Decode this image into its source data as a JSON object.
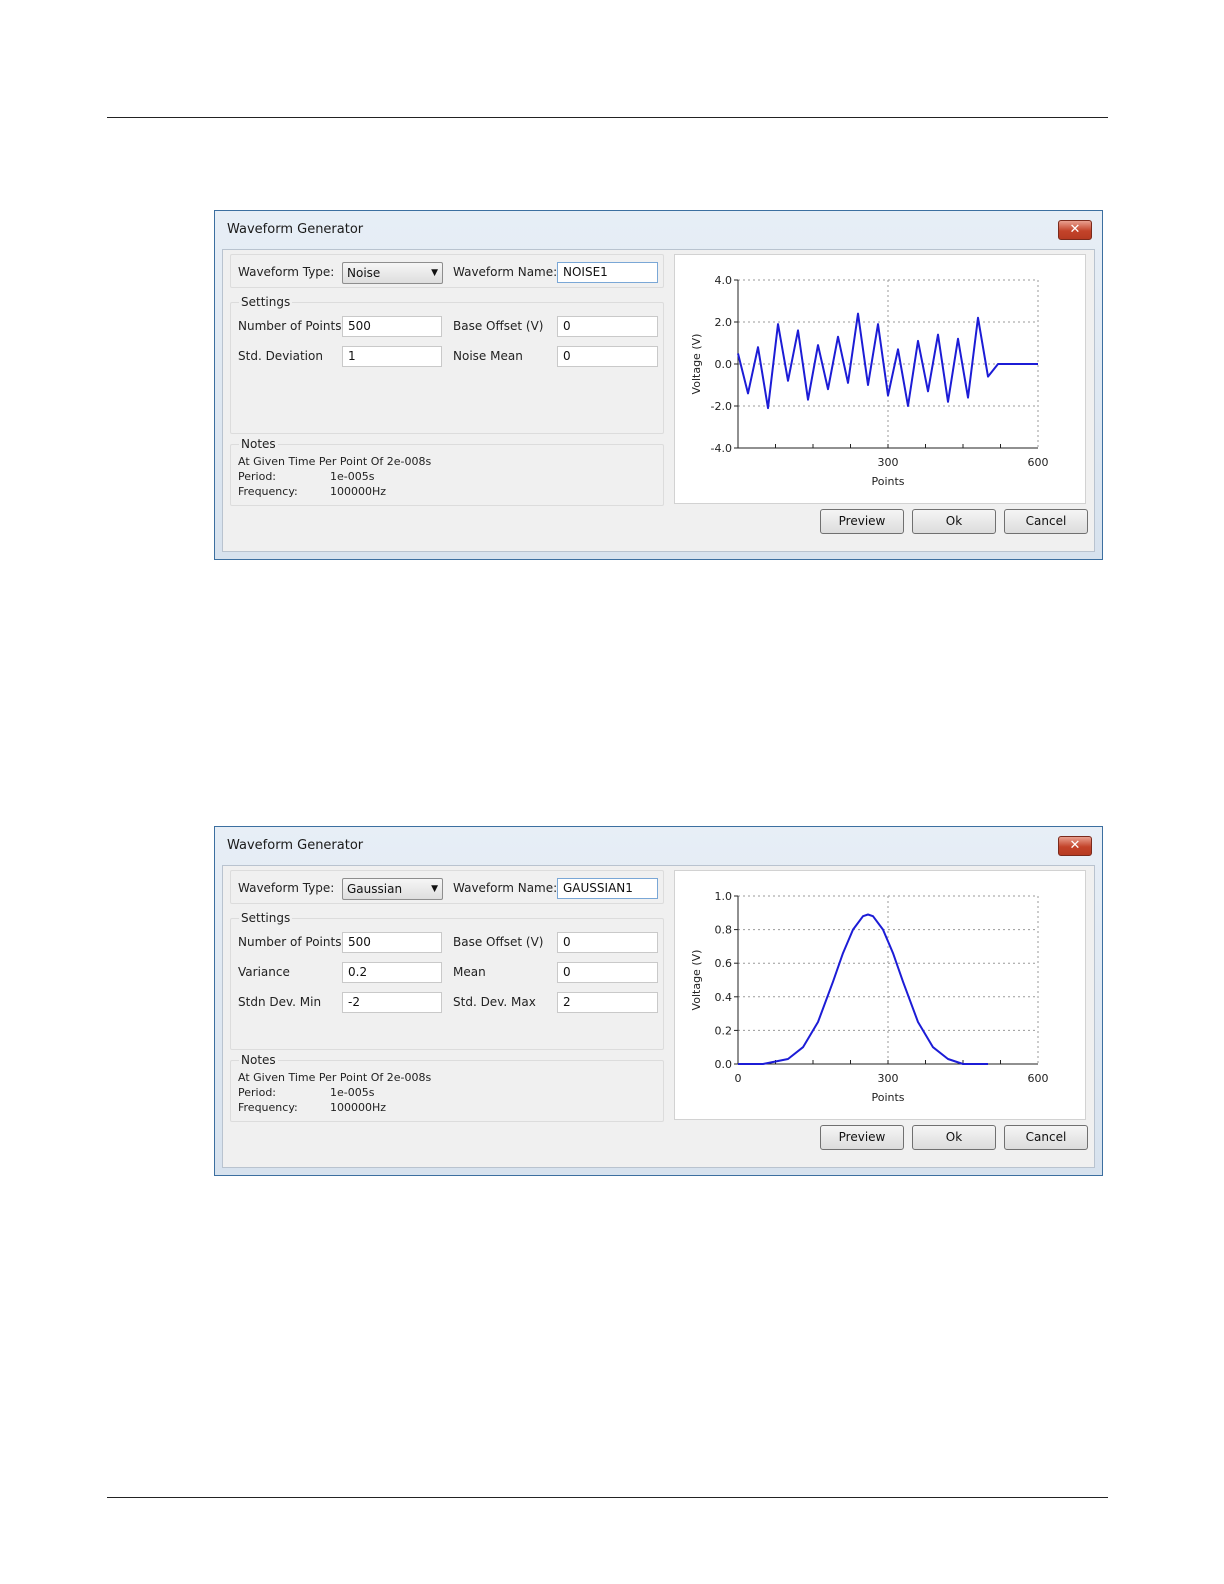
{
  "dialogs": [
    {
      "title": "Waveform Generator",
      "close_label": "✕",
      "waveform_type_label": "Waveform Type:",
      "waveform_type_value": "Noise",
      "waveform_name_label": "Waveform Name:",
      "waveform_name_value": "NOISE1",
      "settings_label": "Settings",
      "fields": [
        {
          "label": "Number of Points",
          "value": "500"
        },
        {
          "label": "Base Offset (V)",
          "value": "0"
        },
        {
          "label": "Std. Deviation",
          "value": "1"
        },
        {
          "label": "Noise Mean",
          "value": "0"
        }
      ],
      "notes_label": "Notes",
      "notes_line1": "At Given Time Per Point Of 2e-008s",
      "period_label": "Period:",
      "period_value": "1e-005s",
      "frequency_label": "Frequency:",
      "frequency_value": "100000Hz",
      "buttons": {
        "preview": "Preview",
        "ok": "Ok",
        "cancel": "Cancel"
      }
    },
    {
      "title": "Waveform Generator",
      "close_label": "✕",
      "waveform_type_label": "Waveform Type:",
      "waveform_type_value": "Gaussian",
      "waveform_name_label": "Waveform Name:",
      "waveform_name_value": "GAUSSIAN1",
      "settings_label": "Settings",
      "fields": [
        {
          "label": "Number of Points",
          "value": "500"
        },
        {
          "label": "Base Offset (V)",
          "value": "0"
        },
        {
          "label": "Variance",
          "value": "0.2"
        },
        {
          "label": "Mean",
          "value": "0"
        },
        {
          "label": "Stdn Dev. Min",
          "value": "-2"
        },
        {
          "label": "Std. Dev. Max",
          "value": "2"
        }
      ],
      "notes_label": "Notes",
      "notes_line1": "At Given Time Per Point Of 2e-008s",
      "period_label": "Period:",
      "period_value": "1e-005s",
      "frequency_label": "Frequency:",
      "frequency_value": "100000Hz",
      "buttons": {
        "preview": "Preview",
        "ok": "Ok",
        "cancel": "Cancel"
      }
    }
  ],
  "chart_data": [
    {
      "type": "line",
      "xlabel": "Points",
      "ylabel": "Voltage (V)",
      "xlim": [
        0,
        600
      ],
      "ylim": [
        -4.0,
        4.0
      ],
      "x_ticks": [
        "300",
        "600"
      ],
      "y_ticks": [
        "4.0",
        "2.0",
        "0.0",
        "-2.0",
        "-4.0"
      ],
      "grid": true,
      "line_color": "#1c1cd6",
      "series": [
        {
          "x": [
            0,
            20,
            40,
            60,
            80,
            100,
            120,
            140,
            160,
            180,
            200,
            220,
            240,
            260,
            280,
            300,
            320,
            340,
            360,
            380,
            400,
            420,
            440,
            460,
            480,
            500,
            520,
            600
          ],
          "y": [
            0.5,
            -1.4,
            0.8,
            -2.1,
            1.9,
            -0.8,
            1.6,
            -1.7,
            0.9,
            -1.2,
            1.3,
            -0.9,
            2.4,
            -1.0,
            1.9,
            -1.5,
            0.7,
            -2.0,
            1.1,
            -1.3,
            1.4,
            -1.8,
            1.2,
            -1.6,
            2.2,
            -0.6,
            0.0,
            0.0
          ]
        }
      ]
    },
    {
      "type": "line",
      "xlabel": "Points",
      "ylabel": "Voltage (V)",
      "xlim": [
        0,
        600
      ],
      "ylim": [
        0.0,
        1.0
      ],
      "x_ticks": [
        "0",
        "300",
        "600"
      ],
      "y_ticks": [
        "1.0",
        "0.8",
        "0.6",
        "0.4",
        "0.2",
        "0.0"
      ],
      "grid": true,
      "line_color": "#1c1cd6",
      "series": [
        {
          "x": [
            0,
            50,
            100,
            130,
            160,
            190,
            210,
            230,
            250,
            260,
            270,
            290,
            310,
            330,
            360,
            390,
            420,
            450,
            500
          ],
          "y": [
            0.0,
            0.0,
            0.03,
            0.1,
            0.25,
            0.49,
            0.66,
            0.8,
            0.88,
            0.89,
            0.88,
            0.8,
            0.66,
            0.49,
            0.25,
            0.1,
            0.03,
            0.0,
            0.0
          ]
        }
      ]
    }
  ]
}
